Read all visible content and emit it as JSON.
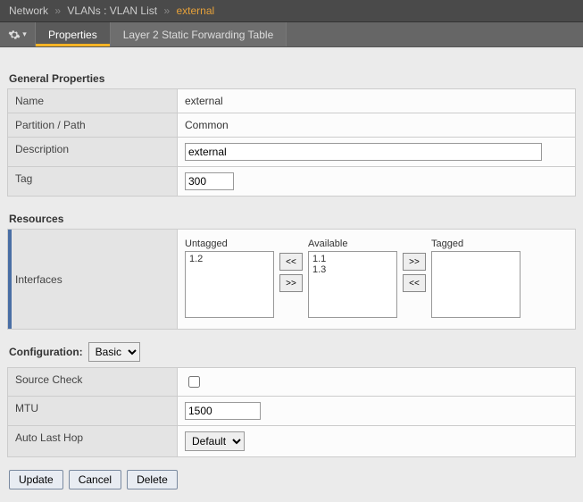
{
  "breadcrumb": {
    "root": "Network",
    "mid": "VLANs : VLAN List",
    "current": "external"
  },
  "tabs": {
    "properties": "Properties",
    "l2sft": "Layer 2 Static Forwarding Table"
  },
  "sections": {
    "general": "General Properties",
    "resources": "Resources"
  },
  "general": {
    "name_label": "Name",
    "name_value": "external",
    "partition_label": "Partition / Path",
    "partition_value": "Common",
    "description_label": "Description",
    "description_value": "external",
    "tag_label": "Tag",
    "tag_value": "300"
  },
  "resources": {
    "interfaces_label": "Interfaces",
    "untagged_label": "Untagged",
    "available_label": "Available",
    "tagged_label": "Tagged",
    "untagged_items": [
      "1.2"
    ],
    "available_items": [
      "1.1",
      "1.3"
    ],
    "tagged_items": []
  },
  "config": {
    "label": "Configuration:",
    "selected": "Basic",
    "source_check_label": "Source Check",
    "source_check_checked": false,
    "mtu_label": "MTU",
    "mtu_value": "1500",
    "alh_label": "Auto Last Hop",
    "alh_selected": "Default"
  },
  "buttons": {
    "update": "Update",
    "cancel": "Cancel",
    "delete": "Delete"
  }
}
